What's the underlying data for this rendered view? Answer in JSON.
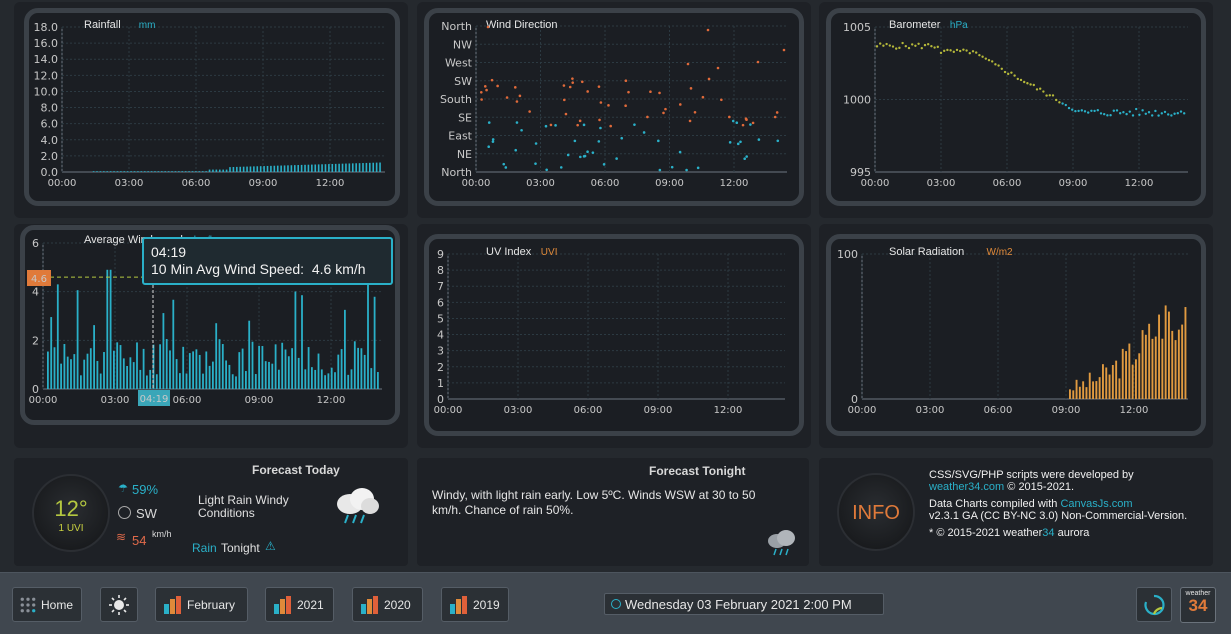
{
  "charts": {
    "rainfall": {
      "title": "Rainfall",
      "unit": "mm",
      "y_ticks": [
        "18.0",
        "16.0",
        "14.0",
        "12.0",
        "10.0",
        "8.0",
        "6.0",
        "4.0",
        "2.0",
        "0.0"
      ],
      "x_ticks": [
        "00:00",
        "03:00",
        "06:00",
        "09:00",
        "12:00"
      ]
    },
    "wind_direction": {
      "title": "Wind Direction",
      "y_ticks": [
        "North",
        "NW",
        "West",
        "SW",
        "South",
        "SE",
        "East",
        "NE",
        "North"
      ],
      "x_ticks": [
        "00:00",
        "03:00",
        "06:00",
        "09:00",
        "12:00"
      ]
    },
    "barometer": {
      "title": "Barometer",
      "unit": "hPa",
      "y_ticks": [
        "1005",
        "1000",
        "995"
      ],
      "x_ticks": [
        "00:00",
        "03:00",
        "06:00",
        "09:00",
        "12:00"
      ]
    },
    "windspeed": {
      "title": "Average Windspeed",
      "unit": "km/h",
      "y_ticks": [
        "6",
        "4",
        "2",
        "0"
      ],
      "x_ticks": [
        "00:00",
        "03:00",
        "06:00",
        "09:00",
        "12:00"
      ],
      "marker_value": "4.6",
      "cursor_time": "04:19",
      "tooltip_time": "04:19",
      "tooltip_text": "10 Min Avg Wind Speed:  4.6 km/h"
    },
    "uv": {
      "title": "UV Index",
      "unit": "UVI",
      "y_ticks": [
        "9",
        "8",
        "7",
        "6",
        "5",
        "4",
        "3",
        "2",
        "1",
        "0"
      ],
      "x_ticks": [
        "00:00",
        "03:00",
        "06:00",
        "09:00",
        "12:00"
      ]
    },
    "solar": {
      "title": "Solar Radiation",
      "unit": "W/m2",
      "y_ticks": [
        "100",
        "0"
      ],
      "x_ticks": [
        "00:00",
        "03:00",
        "06:00",
        "09:00",
        "12:00"
      ]
    }
  },
  "forecast_today": {
    "heading": "Forecast Today",
    "temp": "12°",
    "uvi": "1 UVI",
    "humidity": "59%",
    "wind_dir": "SW",
    "wind_speed": "54",
    "wind_unit": "km/h",
    "conditions": "Light Rain Windy Conditions",
    "rain_word": "Rain",
    "tonight_word": "Tonight"
  },
  "forecast_tonight": {
    "heading": "Forecast Tonight",
    "text": "Windy, with light rain early. Low 5ºC. Winds WSW at 30 to 50 km/h. Chance of rain 50%."
  },
  "info": {
    "badge": "INFO",
    "line1": "CSS/SVG/PHP scripts were developed by",
    "link1": "weather34.com",
    "line1b": "© 2015-2021.",
    "line2a": "Data Charts compiled with",
    "link2": "CanvasJs.com",
    "line2b": "v2.3.1 GA (CC BY-NC 3.0) Non-Commercial-Version.",
    "line3": "* © 2015-2021 weather",
    "line3num": "34",
    "line3b": " aurora"
  },
  "taskbar": {
    "home": "Home",
    "february": "February",
    "y2021": "2021",
    "y2020": "2020",
    "y2019": "2019",
    "datetime": "Wednesday 03 February 2021 2:00 PM",
    "logo_top": "weather",
    "logo_num": "34"
  },
  "colors": {
    "cyan": "#2ab0c8",
    "orange": "#e08a3a",
    "olive": "#b5b83a",
    "frame": "#3b4148"
  }
}
